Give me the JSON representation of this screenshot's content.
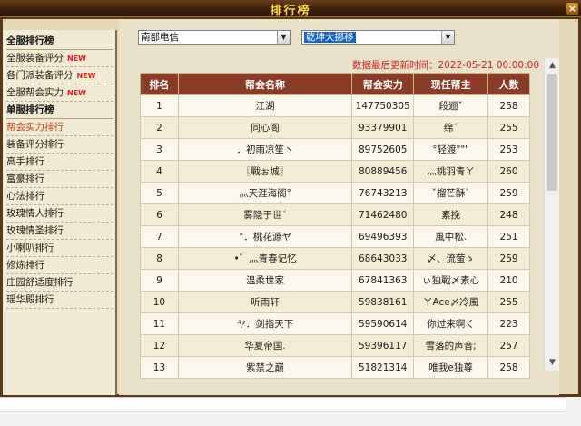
{
  "window": {
    "title": "排行榜",
    "close_label": "×"
  },
  "sidebar": {
    "items": [
      {
        "label": "全服排行榜",
        "type": "head"
      },
      {
        "label": "全服装备评分",
        "new": "NEW"
      },
      {
        "label": "各门派装备评分",
        "new": "NEW"
      },
      {
        "label": "全服帮会实力",
        "new": "NEW"
      },
      {
        "label": "单服排行榜",
        "type": "head"
      },
      {
        "label": "帮会实力排行",
        "active": true
      },
      {
        "label": "装备评分排行"
      },
      {
        "label": "高手排行"
      },
      {
        "label": "富豪排行"
      },
      {
        "label": "心法排行"
      },
      {
        "label": "玫瑰情人排行"
      },
      {
        "label": "玫瑰情圣排行"
      },
      {
        "label": "小喇叭排行"
      },
      {
        "label": "修炼排行"
      },
      {
        "label": "庄园舒适度排行"
      },
      {
        "label": "瑶华殿排行"
      }
    ]
  },
  "filters": {
    "region": {
      "value": "南部电信"
    },
    "server": {
      "value": "乾坤大挪移"
    }
  },
  "update_text": "数据最后更新时间：2022-05-21 00:00:00",
  "table": {
    "headers": [
      "排名",
      "帮会名称",
      "帮会实力",
      "现任帮主",
      "人数"
    ],
    "rows": [
      [
        "1",
        "江湖",
        "147750305",
        "段逦ˇ",
        "258"
      ],
      [
        "2",
        "同心阁",
        "93379901",
        "绵ˊ",
        "255"
      ],
      [
        "3",
        "．初雨凉笙丶",
        "89752605",
        "°轻渡\"\"\"",
        "253"
      ],
      [
        "4",
        "〖戰ぉ城〗",
        "80889456",
        "灬桃羽青ㄚ",
        "260"
      ],
      [
        "5",
        "灬天涯海阁°",
        "76743213",
        "ˇ榴芒酥ˋ",
        "259"
      ],
      [
        "6",
        "雾隐于世ˊ",
        "71462480",
        "素挽",
        "248"
      ],
      [
        "7",
        "°．桃花源ヤ",
        "69496393",
        "風中松.",
        "251"
      ],
      [
        "8",
        "•゛灬青春记忆",
        "68643033",
        "〆、流萤ゝ",
        "259"
      ],
      [
        "9",
        "温柔世家",
        "67841363",
        "ぃ独戰〆素心",
        "210"
      ],
      [
        "10",
        "听雨轩",
        "59838161",
        "ㄚAce〆冷風",
        "255"
      ],
      [
        "11",
        "ヤ．剑指天下",
        "59590614",
        "你过来啊く",
        "223"
      ],
      [
        "12",
        "华夏帝国.",
        "59396117",
        "雪落的声音;",
        "257"
      ],
      [
        "13",
        "紫禁之巅",
        "51821314",
        "唯我e独尊",
        "258"
      ]
    ]
  }
}
